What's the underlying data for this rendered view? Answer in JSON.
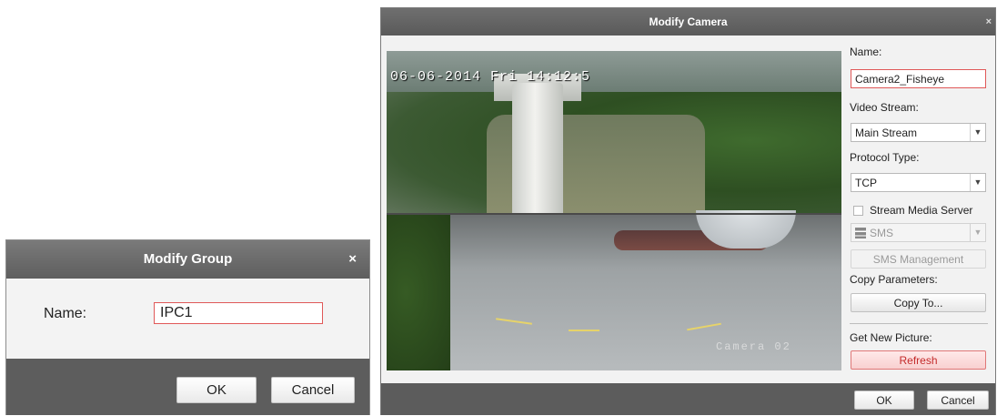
{
  "group_dialog": {
    "title": "Modify Group",
    "close_glyph": "×",
    "name_label": "Name:",
    "name_value": "IPC1",
    "ok_label": "OK",
    "cancel_label": "Cancel"
  },
  "camera_dialog": {
    "title": "Modify Camera",
    "close_glyph": "×",
    "preview": {
      "osd_timestamp": "06-06-2014 Fri 14:12:5",
      "osd_camera_name": "Camera 02"
    },
    "panel": {
      "name_label": "Name:",
      "name_value": "Camera2_Fisheye",
      "video_stream_label": "Video Stream:",
      "video_stream_value": "Main Stream",
      "protocol_type_label": "Protocol Type:",
      "protocol_type_value": "TCP",
      "stream_media_server_label": "Stream Media Server",
      "stream_media_server_checked": false,
      "sms_value": "SMS",
      "sms_management_label": "SMS Management",
      "copy_parameters_label": "Copy Parameters:",
      "copy_to_label": "Copy To...",
      "get_new_picture_label": "Get New Picture:",
      "refresh_label": "Refresh"
    },
    "ok_label": "OK",
    "cancel_label": "Cancel"
  },
  "icons": {
    "dropdown_arrow": "chevron-down-icon",
    "server": "server-icon",
    "close": "close-icon"
  },
  "colors": {
    "title_bar": "#5e5e5e",
    "focus_border": "#e05858",
    "refresh_text": "#c42b2b"
  }
}
